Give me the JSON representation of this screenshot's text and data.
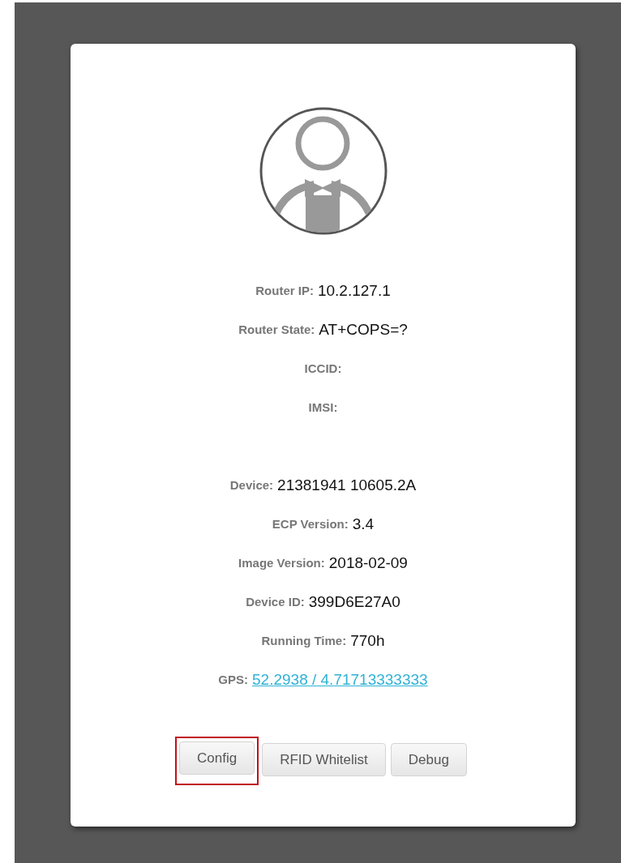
{
  "groups": [
    {
      "fields": [
        {
          "label": "Router IP:",
          "value": "10.2.127.1",
          "kind": "text"
        },
        {
          "label": "Router State:",
          "value": "AT+COPS=?",
          "kind": "text"
        },
        {
          "label": "ICCID:"
        },
        {
          "label": "IMSI:"
        }
      ]
    },
    {
      "fields": [
        {
          "label": "Device:",
          "value": "21381941 10605.2A",
          "kind": "text"
        },
        {
          "label": "ECP Version:",
          "value": "3.4",
          "kind": "text"
        },
        {
          "label": "Image Version:",
          "value": "2018-02-09",
          "kind": "text"
        },
        {
          "label": "Device ID:",
          "value": "399D6E27A0",
          "kind": "text"
        },
        {
          "label": "Running Time:",
          "value": "770h",
          "kind": "text"
        },
        {
          "label": "GPS:",
          "value": "52.2938 / 4.71713333333",
          "kind": "link"
        }
      ]
    }
  ],
  "buttons": [
    {
      "label": "Config",
      "highlighted": true
    },
    {
      "label": "RFID Whitelist",
      "highlighted": false
    },
    {
      "label": "Debug",
      "highlighted": false
    }
  ]
}
